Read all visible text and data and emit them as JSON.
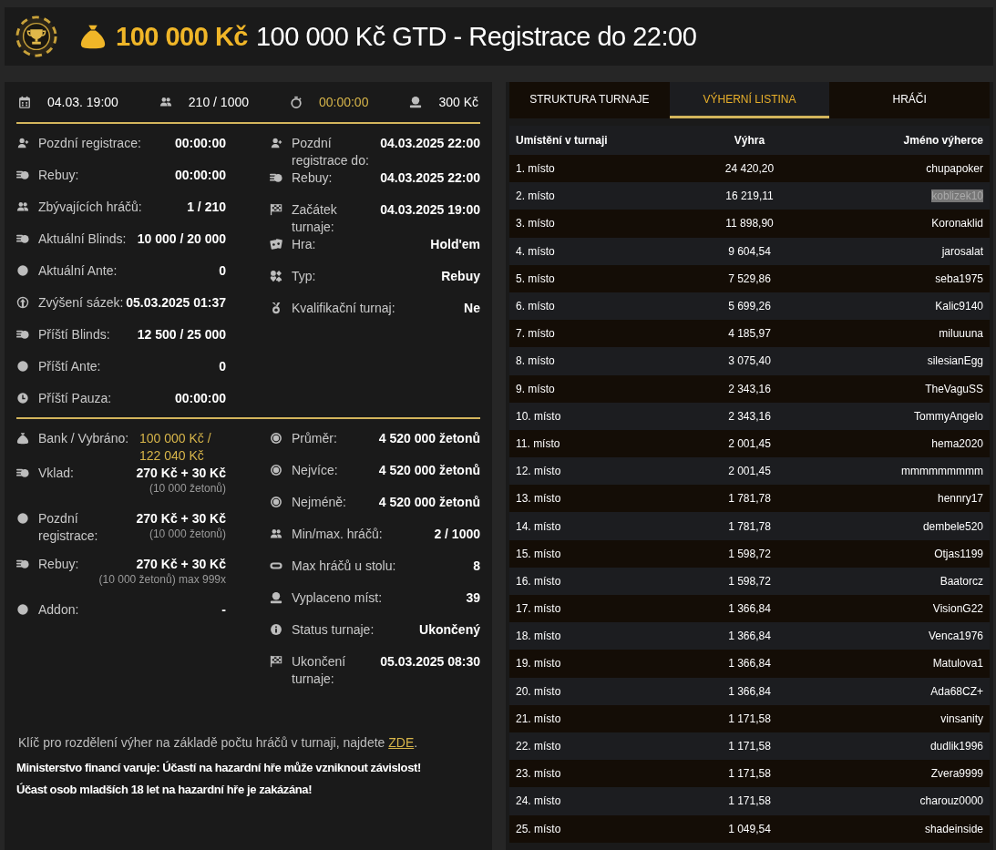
{
  "header": {
    "prize": "100 000 Kč",
    "title": "100 000 Kč GTD - Registrace do 22:00"
  },
  "summary": [
    {
      "kind": "calendar",
      "value": "04.03. 19:00",
      "accent": false
    },
    {
      "kind": "users",
      "value": "210 / 1000",
      "accent": false
    },
    {
      "kind": "stopwatch",
      "value": "00:00:00",
      "accent": true
    },
    {
      "kind": "payout",
      "value": "300 Kč",
      "accent": false
    }
  ],
  "status_left": [
    {
      "kind": "user",
      "label": "Pozdní registrace:",
      "value": "00:00:00"
    },
    {
      "kind": "coins",
      "label": "Rebuy:",
      "value": "00:00:00"
    },
    {
      "kind": "users",
      "label": "Zbývajících hráčů:",
      "value": "1 / 210"
    },
    {
      "kind": "coins",
      "label": "Aktuální Blinds:",
      "value": "10 000 / 20 000"
    },
    {
      "kind": "dollar",
      "label": "Aktuální Ante:",
      "value": "0"
    },
    {
      "kind": "raise",
      "label": "Zvýšení sázek:",
      "value": "05.03.2025 01:37"
    },
    {
      "kind": "coins",
      "label": "Příští Blinds:",
      "value": "12 500 / 25 000"
    },
    {
      "kind": "dollar",
      "label": "Příští Ante:",
      "value": "0"
    },
    {
      "kind": "clock",
      "label": "Příští Pauza:",
      "value": "00:00:00"
    }
  ],
  "status_right": [
    {
      "kind": "user",
      "label": "Pozdní registrace do:",
      "value": "04.03.2025 22:00"
    },
    {
      "kind": "coins",
      "label": "Rebuy:",
      "value": "04.03.2025 22:00"
    },
    {
      "kind": "flag",
      "label": "Začátek turnaje:",
      "value": "04.03.2025 19:00"
    },
    {
      "kind": "cards",
      "label": "Hra:",
      "value": "Hold'em"
    },
    {
      "kind": "suits",
      "label": "Typ:",
      "value": "Rebuy"
    },
    {
      "kind": "medal",
      "label": "Kvalifikační turnaj:",
      "value": "Ne"
    }
  ],
  "money_left": [
    {
      "kind": "moneybag",
      "label": "Bank / Vybráno:",
      "value": "100 000 Kč / 122 040 Kč",
      "accent": true
    },
    {
      "kind": "coins",
      "label": "Vklad:",
      "value": "270 Kč + 30 Kč",
      "note": "(10 000 žetonů)",
      "accent": false
    },
    {
      "kind": "dollar",
      "label": "Pozdní registrace:",
      "value": "270 Kč + 30 Kč",
      "note": "(10 000 žetonů)",
      "accent": false
    },
    {
      "kind": "coins",
      "label": "Rebuy:",
      "value": "270 Kč + 30 Kč",
      "note": "(10 000 žetonů) max 999x",
      "accent": false
    },
    {
      "kind": "dollar",
      "label": "Addon:",
      "value": "-",
      "accent": false
    }
  ],
  "money_right": [
    {
      "kind": "chip",
      "label": "Průměr:",
      "value": "4 520 000 žetonů"
    },
    {
      "kind": "chip",
      "label": "Nejvíce:",
      "value": "4 520 000 žetonů"
    },
    {
      "kind": "chip",
      "label": "Nejméně:",
      "value": "4 520 000 žetonů"
    },
    {
      "kind": "users",
      "label": "Min/max. hráčů:",
      "value": "2 / 1000"
    },
    {
      "kind": "table",
      "label": "Max hráčů u stolu:",
      "value": "8"
    },
    {
      "kind": "payout",
      "label": "Vyplaceno míst:",
      "value": "39"
    },
    {
      "kind": "info",
      "label": "Status turnaje:",
      "value": "Ukončený"
    },
    {
      "kind": "flag",
      "label": "Ukončení turnaje:",
      "value": "05.03.2025 08:30"
    }
  ],
  "note": {
    "text": "Klíč pro rozdělení výher na základě počtu hráčů v turnaji, najdete ",
    "link": "ZDE",
    "end": "."
  },
  "warning": [
    "Ministerstvo financí varuje: Účastí na hazardní hře může vzniknout závislost!",
    "Účast osob mladších 18 let na hazardní hře je zakázána!"
  ],
  "tabs": [
    {
      "label": "STRUKTURA TURNAJE",
      "selected": false
    },
    {
      "label": "VÝHERNÍ LISTINA",
      "selected": true
    },
    {
      "label": "HRÁČI",
      "selected": false
    }
  ],
  "table": {
    "columns": [
      "Umístění v turnaji",
      "Výhra",
      "Jméno výherce"
    ],
    "rows": [
      {
        "place": "1. místo",
        "prize": "24 420,20",
        "name": "chupapoker",
        "highlighted": false
      },
      {
        "place": "2. místo",
        "prize": "16 219,11",
        "name": "koblizek10",
        "highlighted": true
      },
      {
        "place": "3. místo",
        "prize": "11 898,90",
        "name": "Koronaklid",
        "highlighted": false
      },
      {
        "place": "4. místo",
        "prize": "9 604,54",
        "name": "jarosalat",
        "highlighted": false
      },
      {
        "place": "5. místo",
        "prize": "7 529,86",
        "name": "seba1975",
        "highlighted": false
      },
      {
        "place": "6. místo",
        "prize": "5 699,26",
        "name": "Kalic9140",
        "highlighted": false
      },
      {
        "place": "7. místo",
        "prize": "4 185,97",
        "name": "miluuuna",
        "highlighted": false
      },
      {
        "place": "8. místo",
        "prize": "3 075,40",
        "name": "silesianEgg",
        "highlighted": false
      },
      {
        "place": "9. místo",
        "prize": "2 343,16",
        "name": "TheVaguSS",
        "highlighted": false
      },
      {
        "place": "10. místo",
        "prize": "2 343,16",
        "name": "TommyAngelo",
        "highlighted": false
      },
      {
        "place": "11. místo",
        "prize": "2 001,45",
        "name": "hema2020",
        "highlighted": false
      },
      {
        "place": "12. místo",
        "prize": "2 001,45",
        "name": "mmmmmmmmm",
        "highlighted": false
      },
      {
        "place": "13. místo",
        "prize": "1 781,78",
        "name": "hennry17",
        "highlighted": false
      },
      {
        "place": "14. místo",
        "prize": "1 781,78",
        "name": "dembele520",
        "highlighted": false
      },
      {
        "place": "15. místo",
        "prize": "1 598,72",
        "name": "Otjas1199",
        "highlighted": false
      },
      {
        "place": "16. místo",
        "prize": "1 598,72",
        "name": "Baatorcz",
        "highlighted": false
      },
      {
        "place": "17. místo",
        "prize": "1 366,84",
        "name": "VisionG22",
        "highlighted": false
      },
      {
        "place": "18. místo",
        "prize": "1 366,84",
        "name": "Venca1976",
        "highlighted": false
      },
      {
        "place": "19. místo",
        "prize": "1 366,84",
        "name": "Matulova1",
        "highlighted": false
      },
      {
        "place": "20. místo",
        "prize": "1 366,84",
        "name": "Ada68CZ+",
        "highlighted": false
      },
      {
        "place": "21. místo",
        "prize": "1 171,58",
        "name": "vinsanity",
        "highlighted": false
      },
      {
        "place": "22. místo",
        "prize": "1 171,58",
        "name": "dudlik1996",
        "highlighted": false
      },
      {
        "place": "23. místo",
        "prize": "1 171,58",
        "name": "Zvera9999",
        "highlighted": false
      },
      {
        "place": "24. místo",
        "prize": "1 171,58",
        "name": "charouz0000",
        "highlighted": false
      },
      {
        "place": "25. místo",
        "prize": "1 049,54",
        "name": "shadeinside",
        "highlighted": false
      }
    ]
  }
}
